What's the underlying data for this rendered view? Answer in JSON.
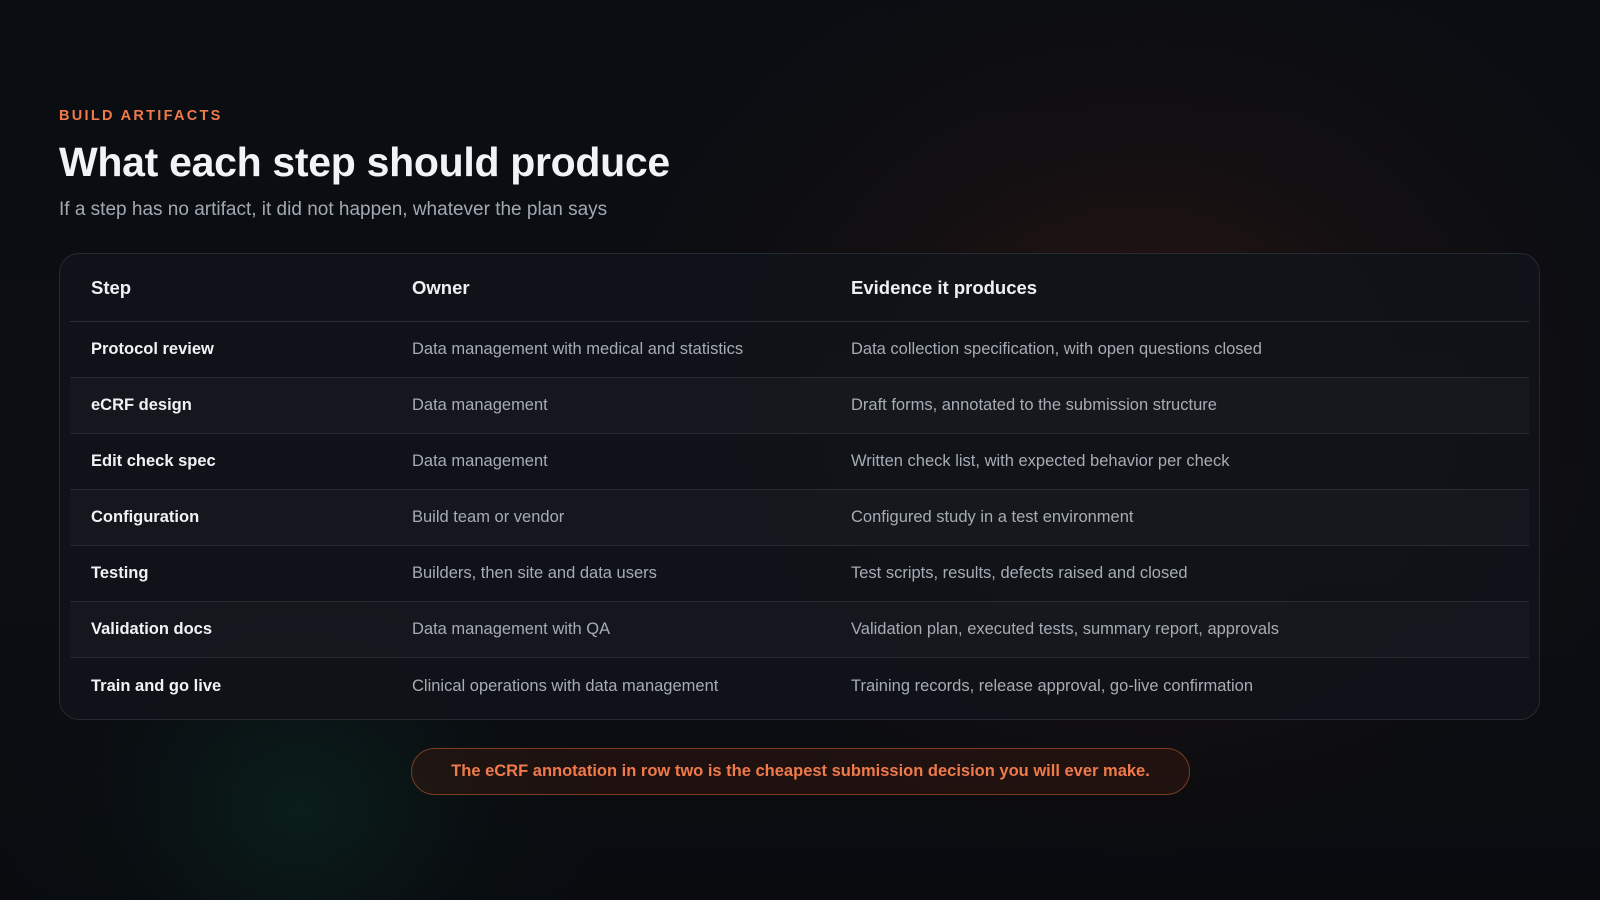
{
  "header": {
    "eyebrow": "BUILD ARTIFACTS",
    "title": "What each step should produce",
    "subtitle": "If a step has no artifact, it did not happen, whatever the plan says"
  },
  "table": {
    "columns": [
      "Step",
      "Owner",
      "Evidence it produces"
    ],
    "rows": [
      {
        "step": "Protocol review",
        "owner": "Data management with medical and statistics",
        "evidence": "Data collection specification, with open questions closed"
      },
      {
        "step": "eCRF design",
        "owner": "Data management",
        "evidence": "Draft forms, annotated to the submission structure"
      },
      {
        "step": "Edit check spec",
        "owner": "Data management",
        "evidence": "Written check list, with expected behavior per check"
      },
      {
        "step": "Configuration",
        "owner": "Build team or vendor",
        "evidence": "Configured study in a test environment"
      },
      {
        "step": "Testing",
        "owner": "Builders, then site and data users",
        "evidence": "Test scripts, results, defects raised and closed"
      },
      {
        "step": "Validation docs",
        "owner": "Data management with QA",
        "evidence": "Validation plan, executed tests, summary report, approvals"
      },
      {
        "step": "Train and go live",
        "owner": "Clinical operations with data management",
        "evidence": "Training records, release approval, go-live confirmation"
      }
    ]
  },
  "callout": {
    "text": "The eCRF annotation in row two is the cheapest submission decision you will ever make."
  },
  "colors": {
    "accent": "#f07a4a",
    "background": "#0b0e13",
    "card": "#101318"
  }
}
